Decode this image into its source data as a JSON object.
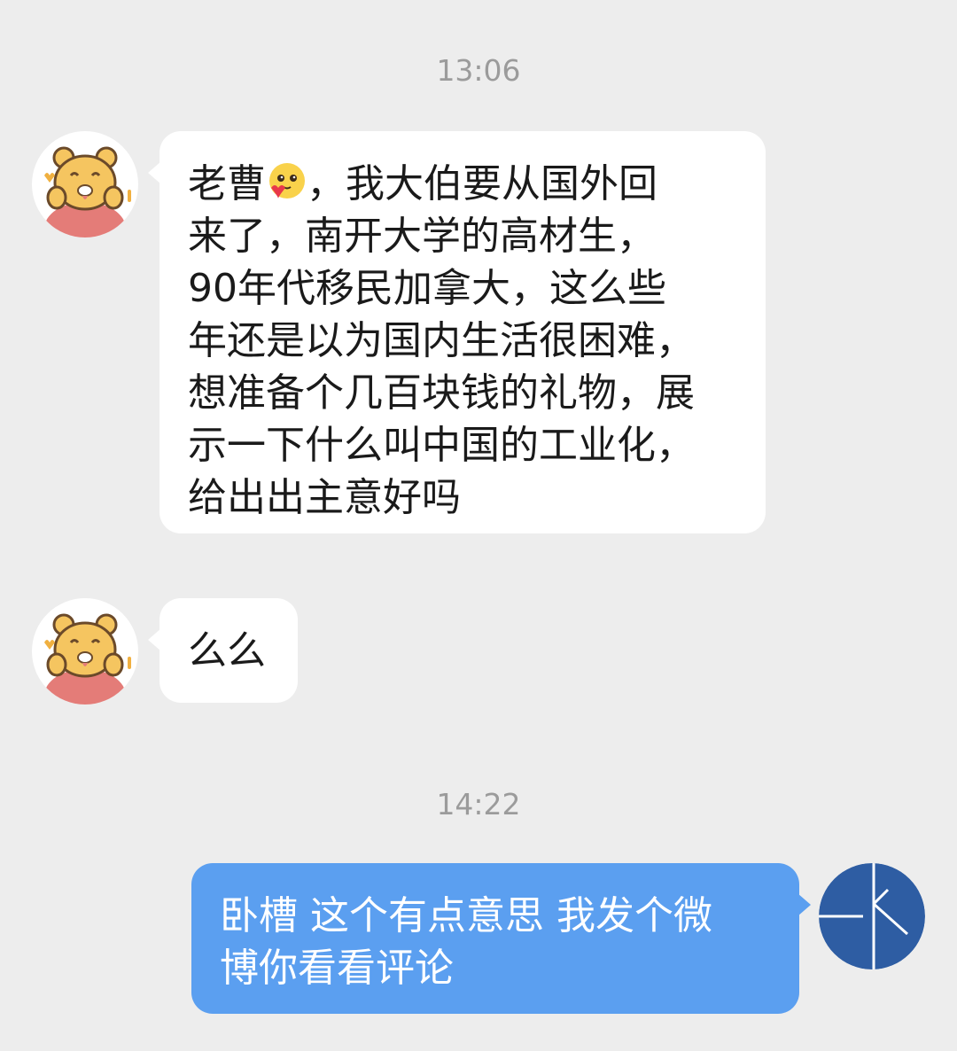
{
  "chat": {
    "timestamps": [
      "13:06",
      "14:22"
    ],
    "messages": [
      {
        "sender": "friend",
        "avatar_icon": "bear-avatar-icon",
        "lines": [
          [
            "老曹",
            "，我大伯要从国外回"
          ],
          "来了，南开大学的高材生，",
          "90年代移民加拿大，这么些",
          "年还是以为国内生活很困难，",
          "想准备个几百块钱的礼物，展",
          "示一下什么叫中国的工业化，",
          "给出出主意好吗"
        ],
        "inline_emoji": "shy-heart-emoji-icon"
      },
      {
        "sender": "friend",
        "avatar_icon": "bear-avatar-icon",
        "text": "么么"
      },
      {
        "sender": "me",
        "avatar_icon": "blue-logo-avatar-icon",
        "lines": [
          "卧槽 这个有点意思 我发个微",
          "博你看看评论"
        ]
      }
    ]
  },
  "colors": {
    "background": "#ededed",
    "incoming_bubble": "#ffffff",
    "outgoing_bubble": "#5b9ff0",
    "timestamp": "#9b9b9b",
    "my_avatar": "#2e5da3"
  }
}
